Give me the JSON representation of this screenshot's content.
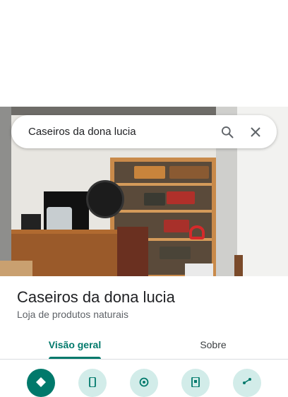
{
  "search": {
    "query": "Caseiros da dona lucia"
  },
  "place": {
    "name": "Caseiros da dona lucia",
    "category": "Loja de produtos naturais"
  },
  "tabs": [
    {
      "label": "Visão geral",
      "selected": true
    },
    {
      "label": "Sobre",
      "selected": false
    }
  ],
  "icons": {
    "search": "search-icon",
    "close": "close-icon",
    "actions": [
      "directions-icon",
      "phone-icon",
      "location-pin-icon",
      "save-icon",
      "share-icon"
    ]
  },
  "colors": {
    "accent": "#00796b",
    "action_bg": "#d2ece9",
    "title": "#202124",
    "subtitle": "#5f6368"
  }
}
